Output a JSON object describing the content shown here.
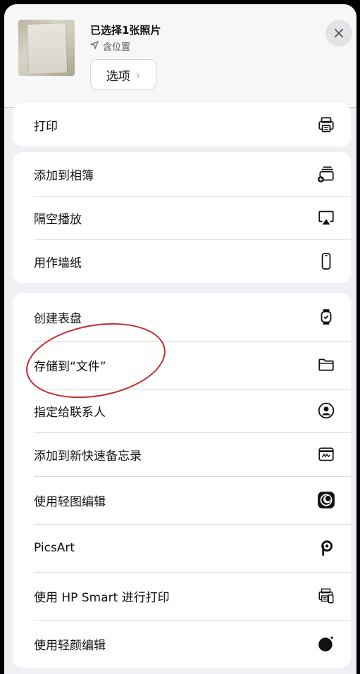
{
  "header": {
    "title": "已选择1张照片",
    "subtitle": "含位置",
    "options_label": "选项",
    "close_symbol": "×"
  },
  "groups": [
    {
      "items": [
        {
          "label": "打印",
          "icon": "printer-icon"
        }
      ]
    },
    {
      "items": [
        {
          "label": "添加到相簿",
          "icon": "add-to-album-icon"
        },
        {
          "label": "隔空播放",
          "icon": "airplay-icon"
        },
        {
          "label": "用作墙纸",
          "icon": "phone-icon"
        }
      ]
    },
    {
      "items": [
        {
          "label": "创建表盘",
          "icon": "watch-icon"
        },
        {
          "label": "存储到“文件”",
          "icon": "folder-icon"
        },
        {
          "label": "指定给联系人",
          "icon": "contact-icon"
        },
        {
          "label": "添加到新快速备忘录",
          "icon": "quick-note-icon"
        },
        {
          "label": "使用轻图编辑",
          "icon": "lightpic-app-icon"
        },
        {
          "label": "PicsArt",
          "icon": "picsart-icon"
        },
        {
          "label": "使用 HP Smart 进行打印",
          "icon": "hp-smart-print-icon"
        },
        {
          "label": "使用轻颜编辑",
          "icon": "qingyan-app-icon"
        }
      ]
    }
  ],
  "colors": {
    "annotation": "#c42a2a",
    "background": "#efeff4"
  }
}
